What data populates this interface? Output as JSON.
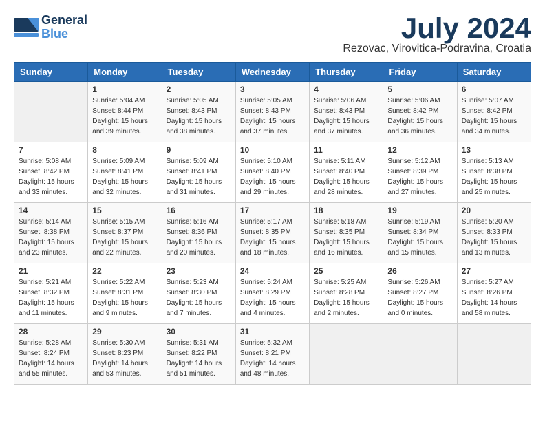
{
  "header": {
    "logo_general": "General",
    "logo_blue": "Blue",
    "month": "July 2024",
    "location": "Rezovac, Virovitica-Podravina, Croatia"
  },
  "weekdays": [
    "Sunday",
    "Monday",
    "Tuesday",
    "Wednesday",
    "Thursday",
    "Friday",
    "Saturday"
  ],
  "weeks": [
    [
      {
        "day": "",
        "lines": []
      },
      {
        "day": "1",
        "lines": [
          "Sunrise: 5:04 AM",
          "Sunset: 8:44 PM",
          "Daylight: 15 hours",
          "and 39 minutes."
        ]
      },
      {
        "day": "2",
        "lines": [
          "Sunrise: 5:05 AM",
          "Sunset: 8:43 PM",
          "Daylight: 15 hours",
          "and 38 minutes."
        ]
      },
      {
        "day": "3",
        "lines": [
          "Sunrise: 5:05 AM",
          "Sunset: 8:43 PM",
          "Daylight: 15 hours",
          "and 37 minutes."
        ]
      },
      {
        "day": "4",
        "lines": [
          "Sunrise: 5:06 AM",
          "Sunset: 8:43 PM",
          "Daylight: 15 hours",
          "and 37 minutes."
        ]
      },
      {
        "day": "5",
        "lines": [
          "Sunrise: 5:06 AM",
          "Sunset: 8:42 PM",
          "Daylight: 15 hours",
          "and 36 minutes."
        ]
      },
      {
        "day": "6",
        "lines": [
          "Sunrise: 5:07 AM",
          "Sunset: 8:42 PM",
          "Daylight: 15 hours",
          "and 34 minutes."
        ]
      }
    ],
    [
      {
        "day": "7",
        "lines": [
          "Sunrise: 5:08 AM",
          "Sunset: 8:42 PM",
          "Daylight: 15 hours",
          "and 33 minutes."
        ]
      },
      {
        "day": "8",
        "lines": [
          "Sunrise: 5:09 AM",
          "Sunset: 8:41 PM",
          "Daylight: 15 hours",
          "and 32 minutes."
        ]
      },
      {
        "day": "9",
        "lines": [
          "Sunrise: 5:09 AM",
          "Sunset: 8:41 PM",
          "Daylight: 15 hours",
          "and 31 minutes."
        ]
      },
      {
        "day": "10",
        "lines": [
          "Sunrise: 5:10 AM",
          "Sunset: 8:40 PM",
          "Daylight: 15 hours",
          "and 29 minutes."
        ]
      },
      {
        "day": "11",
        "lines": [
          "Sunrise: 5:11 AM",
          "Sunset: 8:40 PM",
          "Daylight: 15 hours",
          "and 28 minutes."
        ]
      },
      {
        "day": "12",
        "lines": [
          "Sunrise: 5:12 AM",
          "Sunset: 8:39 PM",
          "Daylight: 15 hours",
          "and 27 minutes."
        ]
      },
      {
        "day": "13",
        "lines": [
          "Sunrise: 5:13 AM",
          "Sunset: 8:38 PM",
          "Daylight: 15 hours",
          "and 25 minutes."
        ]
      }
    ],
    [
      {
        "day": "14",
        "lines": [
          "Sunrise: 5:14 AM",
          "Sunset: 8:38 PM",
          "Daylight: 15 hours",
          "and 23 minutes."
        ]
      },
      {
        "day": "15",
        "lines": [
          "Sunrise: 5:15 AM",
          "Sunset: 8:37 PM",
          "Daylight: 15 hours",
          "and 22 minutes."
        ]
      },
      {
        "day": "16",
        "lines": [
          "Sunrise: 5:16 AM",
          "Sunset: 8:36 PM",
          "Daylight: 15 hours",
          "and 20 minutes."
        ]
      },
      {
        "day": "17",
        "lines": [
          "Sunrise: 5:17 AM",
          "Sunset: 8:35 PM",
          "Daylight: 15 hours",
          "and 18 minutes."
        ]
      },
      {
        "day": "18",
        "lines": [
          "Sunrise: 5:18 AM",
          "Sunset: 8:35 PM",
          "Daylight: 15 hours",
          "and 16 minutes."
        ]
      },
      {
        "day": "19",
        "lines": [
          "Sunrise: 5:19 AM",
          "Sunset: 8:34 PM",
          "Daylight: 15 hours",
          "and 15 minutes."
        ]
      },
      {
        "day": "20",
        "lines": [
          "Sunrise: 5:20 AM",
          "Sunset: 8:33 PM",
          "Daylight: 15 hours",
          "and 13 minutes."
        ]
      }
    ],
    [
      {
        "day": "21",
        "lines": [
          "Sunrise: 5:21 AM",
          "Sunset: 8:32 PM",
          "Daylight: 15 hours",
          "and 11 minutes."
        ]
      },
      {
        "day": "22",
        "lines": [
          "Sunrise: 5:22 AM",
          "Sunset: 8:31 PM",
          "Daylight: 15 hours",
          "and 9 minutes."
        ]
      },
      {
        "day": "23",
        "lines": [
          "Sunrise: 5:23 AM",
          "Sunset: 8:30 PM",
          "Daylight: 15 hours",
          "and 7 minutes."
        ]
      },
      {
        "day": "24",
        "lines": [
          "Sunrise: 5:24 AM",
          "Sunset: 8:29 PM",
          "Daylight: 15 hours",
          "and 4 minutes."
        ]
      },
      {
        "day": "25",
        "lines": [
          "Sunrise: 5:25 AM",
          "Sunset: 8:28 PM",
          "Daylight: 15 hours",
          "and 2 minutes."
        ]
      },
      {
        "day": "26",
        "lines": [
          "Sunrise: 5:26 AM",
          "Sunset: 8:27 PM",
          "Daylight: 15 hours",
          "and 0 minutes."
        ]
      },
      {
        "day": "27",
        "lines": [
          "Sunrise: 5:27 AM",
          "Sunset: 8:26 PM",
          "Daylight: 14 hours",
          "and 58 minutes."
        ]
      }
    ],
    [
      {
        "day": "28",
        "lines": [
          "Sunrise: 5:28 AM",
          "Sunset: 8:24 PM",
          "Daylight: 14 hours",
          "and 55 minutes."
        ]
      },
      {
        "day": "29",
        "lines": [
          "Sunrise: 5:30 AM",
          "Sunset: 8:23 PM",
          "Daylight: 14 hours",
          "and 53 minutes."
        ]
      },
      {
        "day": "30",
        "lines": [
          "Sunrise: 5:31 AM",
          "Sunset: 8:22 PM",
          "Daylight: 14 hours",
          "and 51 minutes."
        ]
      },
      {
        "day": "31",
        "lines": [
          "Sunrise: 5:32 AM",
          "Sunset: 8:21 PM",
          "Daylight: 14 hours",
          "and 48 minutes."
        ]
      },
      {
        "day": "",
        "lines": []
      },
      {
        "day": "",
        "lines": []
      },
      {
        "day": "",
        "lines": []
      }
    ]
  ]
}
